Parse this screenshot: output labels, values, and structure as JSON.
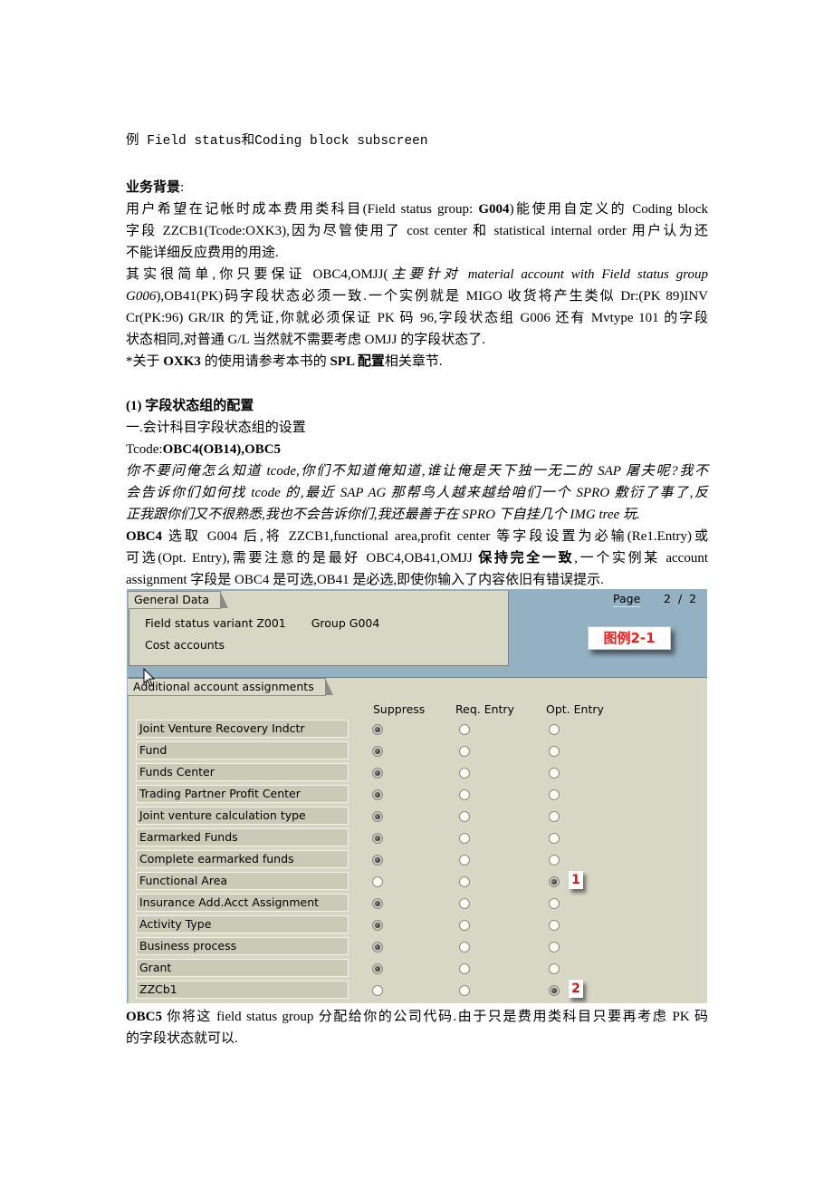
{
  "document": {
    "title": "例 Field status和Coding block subscreen",
    "background_heading": "业务背景",
    "background_colon": ":",
    "p1_line1_a": "用户希望在记帐时成本费用类科目(Field status group: ",
    "p1_line1_b": "G004",
    "p1_line1_c": ")能使用自定义的 Coding block",
    "p1_line2": "字段 ZZCB1(Tcode:OXK3),因为尽管使用了 cost center 和 statistical internal order 用户认为还",
    "p1_line3": "不能详细反应费用的用途.",
    "p2_line1_a": "其实很简单,你只要保证 OBC4,OMJJ(",
    "p2_line1_b": "主要针对 material account with Field status group",
    "p2_line2_a": "G006",
    "p2_line2_b": "),OB41(PK)码字段状态必须一致.一个实例就是 MIGO 收货将产生类似 Dr:(PK 89)INV",
    "p2_line3": "Cr(PK:96) GR/IR 的凭证,你就必须保证 PK 码 96,字段状态组 G006 还有 Mvtype 101 的字段",
    "p2_line4": "状态相同,对普通 G/L 当然就不需要考虑 OMJJ 的字段状态了.",
    "note_a": "*关于 ",
    "note_b": "OXK3",
    "note_c": " 的使用请参考本书的 ",
    "note_d": "SPL 配置",
    "note_e": "相关章节.",
    "section_heading": "(1)  字段状态组的配置",
    "sub_heading": "一.会计科目字段状态组的设置",
    "tcode_label": "Tcode:",
    "tcode_value": "OBC4(OB14),OBC5",
    "italic_line1": "你不要问俺怎么知道 tcode,你们不知道俺知道,谁让俺是天下独一无二的 SAP 屠夫呢?我不",
    "italic_line2": "会告诉你们如何找 tcode 的,最近 SAP AG 那帮鸟人越来越给咱们一个 SPRO 敷衍了事了,反",
    "italic_line3": "正我跟你们又不很熟悉,我也不会告诉你们,我还最善于在 SPRO 下自挂几个 IMG tree 玩.",
    "obc4_a": "OBC4",
    "obc4_line1": " 选取 G004 后,将 ZZCB1,functional area,profit center 等字段设置为必输(Re1.Entry)或",
    "obc4_line2_a": "可选(Opt. Entry),需要注意的是最好 OBC4,OB41,OMJJ ",
    "obc4_line2_b": "保持完全一致",
    "obc4_line2_c": ",一个实例某 account",
    "obc4_line3": "assignment 字段是 OBC4 是可选,OB41 是必选,即使你输入了内容依旧有错误提示.",
    "obc5_a": "OBC5",
    "obc5_line1": " 你将这 field status group 分配给你的公司代码.由于只是费用类科目只要再考虑 PK 码",
    "obc5_line2": "的字段状态就可以."
  },
  "sap_screen": {
    "general_data_tab": "General Data",
    "field_status_variant": "Field status variant Z001",
    "group": "Group G004",
    "group_text": "Cost accounts",
    "page_label": "Page",
    "page_current": "2",
    "page_sep": "/",
    "page_total": "2",
    "figure_label": "图例2-1",
    "additional_tab": "Additional account assignments",
    "columns": [
      "Suppress",
      "Req. Entry",
      "Opt. Entry"
    ],
    "rows": [
      {
        "label": "Joint Venture Recovery Indctr",
        "selected": "Suppress",
        "callout": ""
      },
      {
        "label": "Fund",
        "selected": "Suppress",
        "callout": ""
      },
      {
        "label": "Funds Center",
        "selected": "Suppress",
        "callout": ""
      },
      {
        "label": "Trading Partner Profit Center",
        "selected": "Suppress",
        "callout": ""
      },
      {
        "label": "Joint venture calculation type",
        "selected": "Suppress",
        "callout": ""
      },
      {
        "label": "Earmarked Funds",
        "selected": "Suppress",
        "callout": ""
      },
      {
        "label": "Complete earmarked funds",
        "selected": "Suppress",
        "callout": ""
      },
      {
        "label": "Functional Area",
        "selected": "Opt. Entry",
        "callout": "1"
      },
      {
        "label": "Insurance Add.Acct Assignment",
        "selected": "Suppress",
        "callout": ""
      },
      {
        "label": "Activity Type",
        "selected": "Suppress",
        "callout": ""
      },
      {
        "label": "Business process",
        "selected": "Suppress",
        "callout": ""
      },
      {
        "label": "Grant",
        "selected": "Suppress",
        "callout": ""
      },
      {
        "label": "ZZCb1",
        "selected": "Opt. Entry",
        "callout": "2"
      }
    ],
    "colors": {
      "frame_bg": "#94b0c3",
      "panel_bg": "#d8d7c6",
      "callout_text": "#e01010"
    }
  }
}
